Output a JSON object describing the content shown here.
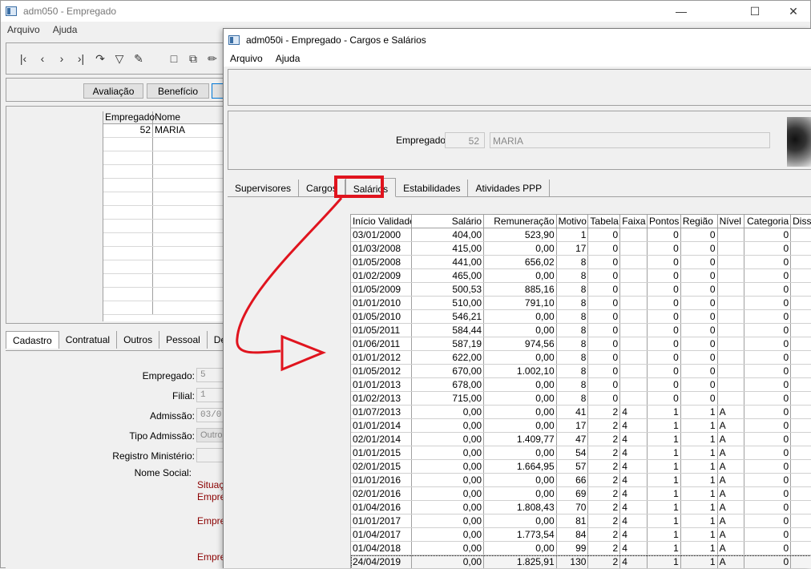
{
  "back_window": {
    "title": "adm050 - Empregado",
    "menu": [
      "Arquivo",
      "Ajuda"
    ],
    "buttons": {
      "avaliacao": "Avaliação",
      "beneficio": "Benefício"
    },
    "grid": {
      "headers": [
        "Empregado",
        "Nome"
      ],
      "rows": [
        {
          "code": "52",
          "name": "MARIA"
        }
      ]
    },
    "tabs": [
      "Cadastro",
      "Contratual",
      "Outros",
      "Pessoal",
      "Depe"
    ],
    "form": {
      "empregado_label": "Empregado:",
      "empregado_value": "5",
      "filial_label": "Filial:",
      "filial_value": "1",
      "admissao_label": "Admissão:",
      "admissao_value": "03/0:",
      "tipo_admissao_label": "Tipo Admissão:",
      "tipo_admissao_value": "Outros",
      "registro_label": "Registro Ministério:",
      "nome_social_label": "Nome Social:",
      "situacao_text": "Situaçã",
      "empreg_1": "Empreg",
      "empreg_2": "Empreg",
      "empreg_3": "Empreg"
    }
  },
  "front_window": {
    "title": "adm050i - Empregado - Cargos e Salários",
    "menu": [
      "Arquivo",
      "Ajuda"
    ],
    "empregado_label": "Empregado:",
    "empregado_code": "52",
    "empregado_name": "MARIA",
    "tabs": [
      "Supervisores",
      "Cargos",
      "Salários",
      "Estabilidades",
      "Atividades PPP"
    ],
    "active_tab": "Salários"
  },
  "salarios_grid": {
    "headers": [
      "Início Validade",
      "Salário",
      "Remuneração",
      "Motivo",
      "Tabela",
      "Faixa",
      "Pontos",
      "Região",
      "Nível",
      "Categoria",
      "Dissi"
    ],
    "rows": [
      [
        "03/01/2000",
        "404,00",
        "523,90",
        "1",
        "0",
        "",
        "0",
        "0",
        "",
        "0",
        ""
      ],
      [
        "01/03/2008",
        "415,00",
        "0,00",
        "17",
        "0",
        "",
        "0",
        "0",
        "",
        "0",
        ""
      ],
      [
        "01/05/2008",
        "441,00",
        "656,02",
        "8",
        "0",
        "",
        "0",
        "0",
        "",
        "0",
        ""
      ],
      [
        "01/02/2009",
        "465,00",
        "0,00",
        "8",
        "0",
        "",
        "0",
        "0",
        "",
        "0",
        ""
      ],
      [
        "01/05/2009",
        "500,53",
        "885,16",
        "8",
        "0",
        "",
        "0",
        "0",
        "",
        "0",
        ""
      ],
      [
        "01/01/2010",
        "510,00",
        "791,10",
        "8",
        "0",
        "",
        "0",
        "0",
        "",
        "0",
        ""
      ],
      [
        "01/05/2010",
        "546,21",
        "0,00",
        "8",
        "0",
        "",
        "0",
        "0",
        "",
        "0",
        ""
      ],
      [
        "01/05/2011",
        "584,44",
        "0,00",
        "8",
        "0",
        "",
        "0",
        "0",
        "",
        "0",
        ""
      ],
      [
        "01/06/2011",
        "587,19",
        "974,56",
        "8",
        "0",
        "",
        "0",
        "0",
        "",
        "0",
        ""
      ],
      [
        "01/01/2012",
        "622,00",
        "0,00",
        "8",
        "0",
        "",
        "0",
        "0",
        "",
        "0",
        ""
      ],
      [
        "01/05/2012",
        "670,00",
        "1.002,10",
        "8",
        "0",
        "",
        "0",
        "0",
        "",
        "0",
        ""
      ],
      [
        "01/01/2013",
        "678,00",
        "0,00",
        "8",
        "0",
        "",
        "0",
        "0",
        "",
        "0",
        ""
      ],
      [
        "01/02/2013",
        "715,00",
        "0,00",
        "8",
        "0",
        "",
        "0",
        "0",
        "",
        "0",
        ""
      ],
      [
        "01/07/2013",
        "0,00",
        "0,00",
        "41",
        "2",
        "4",
        "1",
        "1",
        "A",
        "0",
        ""
      ],
      [
        "01/01/2014",
        "0,00",
        "0,00",
        "17",
        "2",
        "4",
        "1",
        "1",
        "A",
        "0",
        ""
      ],
      [
        "02/01/2014",
        "0,00",
        "1.409,77",
        "47",
        "2",
        "4",
        "1",
        "1",
        "A",
        "0",
        ""
      ],
      [
        "01/01/2015",
        "0,00",
        "0,00",
        "54",
        "2",
        "4",
        "1",
        "1",
        "A",
        "0",
        ""
      ],
      [
        "02/01/2015",
        "0,00",
        "1.664,95",
        "57",
        "2",
        "4",
        "1",
        "1",
        "A",
        "0",
        ""
      ],
      [
        "01/01/2016",
        "0,00",
        "0,00",
        "66",
        "2",
        "4",
        "1",
        "1",
        "A",
        "0",
        ""
      ],
      [
        "02/01/2016",
        "0,00",
        "0,00",
        "69",
        "2",
        "4",
        "1",
        "1",
        "A",
        "0",
        ""
      ],
      [
        "01/04/2016",
        "0,00",
        "1.808,43",
        "70",
        "2",
        "4",
        "1",
        "1",
        "A",
        "0",
        ""
      ],
      [
        "01/01/2017",
        "0,00",
        "0,00",
        "81",
        "2",
        "4",
        "1",
        "1",
        "A",
        "0",
        ""
      ],
      [
        "01/04/2017",
        "0,00",
        "1.773,54",
        "84",
        "2",
        "4",
        "1",
        "1",
        "A",
        "0",
        ""
      ],
      [
        "01/04/2018",
        "0,00",
        "0,00",
        "99",
        "2",
        "4",
        "1",
        "1",
        "A",
        "0",
        ""
      ],
      [
        "24/04/2019",
        "0,00",
        "1.825,91",
        "130",
        "2",
        "4",
        "1",
        "1",
        "A",
        "0",
        ""
      ]
    ],
    "selected_row": 24
  },
  "colors": {
    "annotation": "#e0141e",
    "form_red_text": "#8b0000"
  }
}
